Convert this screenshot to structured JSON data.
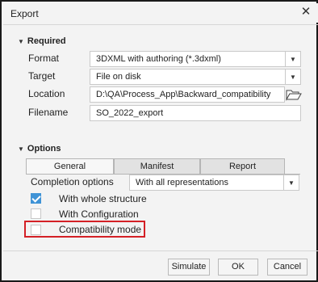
{
  "window": {
    "title": "Export"
  },
  "required": {
    "header": "Required",
    "format": {
      "label": "Format",
      "value": "3DXML with authoring (*.3dxml)"
    },
    "target": {
      "label": "Target",
      "value": "File on disk"
    },
    "location": {
      "label": "Location",
      "value": "D:\\QA\\Process_App\\Backward_compatibility"
    },
    "filename": {
      "label": "Filename",
      "value": "SO_2022_export"
    }
  },
  "options": {
    "header": "Options",
    "tabs": [
      {
        "label": "General",
        "active": true
      },
      {
        "label": "Manifest",
        "active": false
      },
      {
        "label": "Report",
        "active": false
      }
    ],
    "completion": {
      "label": "Completion options",
      "value": "With all representations"
    },
    "checkboxes": [
      {
        "label": "With whole structure",
        "checked": true
      },
      {
        "label": "With Configuration",
        "checked": false
      },
      {
        "label": "Compatibility mode",
        "checked": false,
        "highlighted": true
      }
    ]
  },
  "buttons": {
    "simulate": "Simulate",
    "ok": "OK",
    "cancel": "Cancel"
  },
  "colors": {
    "checkbox_checked": "#3f93d6",
    "highlight_border": "#d42026"
  }
}
